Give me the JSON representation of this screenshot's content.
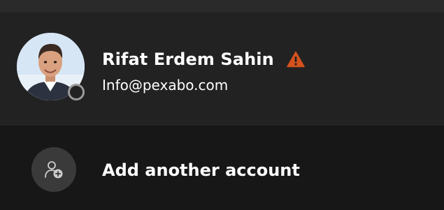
{
  "account": {
    "name": "Rifat Erdem Sahin",
    "email": "Info@pexabo.com",
    "status_icon": "warning-icon",
    "presence_icon": "offline-presence-icon"
  },
  "actions": {
    "add_account_label": "Add another account",
    "add_account_icon": "add-person-icon"
  },
  "colors": {
    "background": "#171717",
    "card": "#222222",
    "warning": "#d4521e",
    "icon_circle": "#3a3a3a"
  }
}
